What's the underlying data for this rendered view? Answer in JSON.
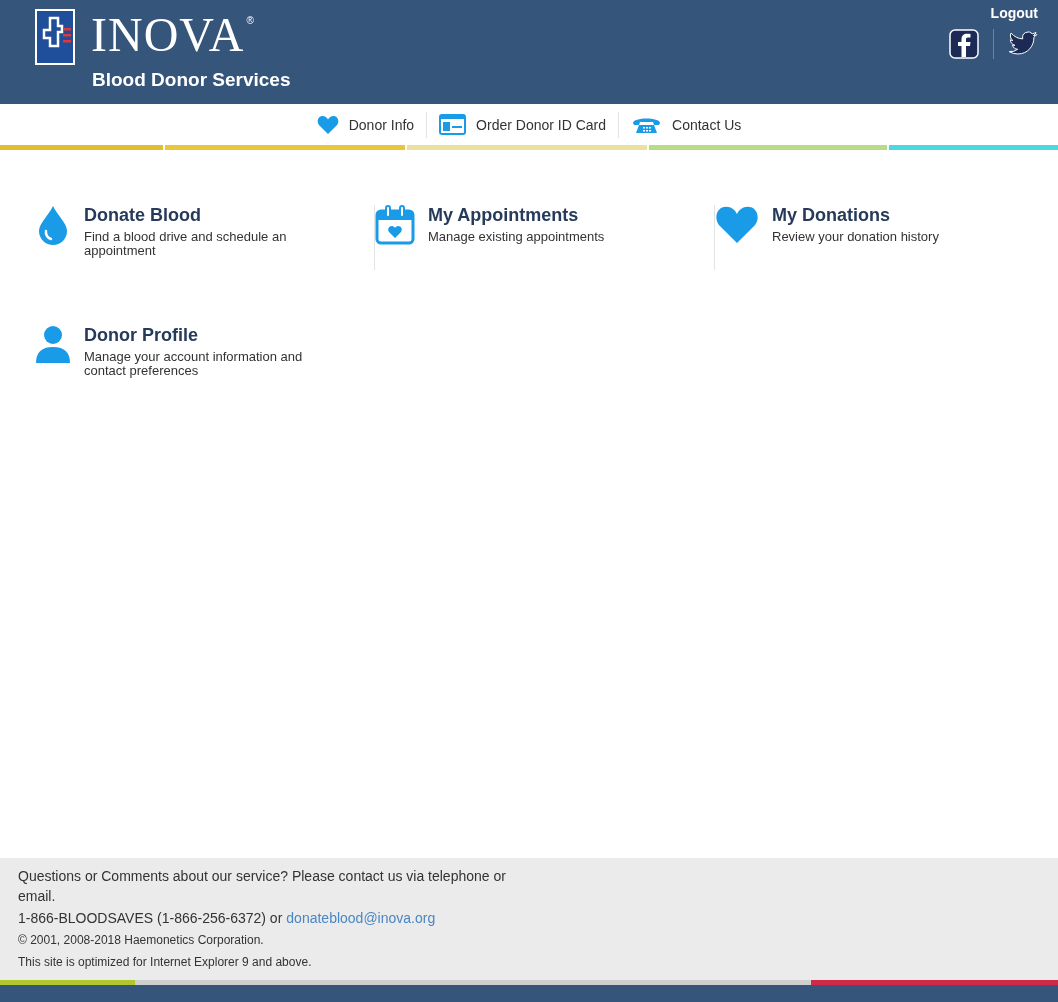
{
  "header": {
    "logo": {
      "wordmark": "INOVA",
      "registered": "®",
      "subtitle": "Blood Donor Services"
    },
    "logout": "Logout"
  },
  "nav": [
    {
      "label": "Donor Info",
      "kind": "heart"
    },
    {
      "label": "Order Donor ID Card",
      "kind": "card"
    },
    {
      "label": "Contact Us",
      "kind": "phone"
    }
  ],
  "tiles": [
    {
      "title": "Donate Blood",
      "description": "Find a blood drive and schedule an appointment",
      "kind": "drop"
    },
    {
      "title": "My Appointments",
      "description": "Manage existing appointments",
      "kind": "calendar"
    },
    {
      "title": "My Donations",
      "description": "Review your donation history",
      "kind": "heart"
    },
    {
      "title": "Donor Profile",
      "description": "Manage your account information and contact preferences",
      "kind": "person"
    }
  ],
  "footer": {
    "question": "Questions or Comments about our service? Please contact us via telephone or email.",
    "phone": "1-866-BLOODSAVES (1-866-256-6372) or",
    "email": "donateblood@inova.org",
    "copyright": "© 2001, 2008-2018 Haemonetics Corporation.",
    "browser_note": "This site is optimized for Internet Explorer 9 and above."
  }
}
